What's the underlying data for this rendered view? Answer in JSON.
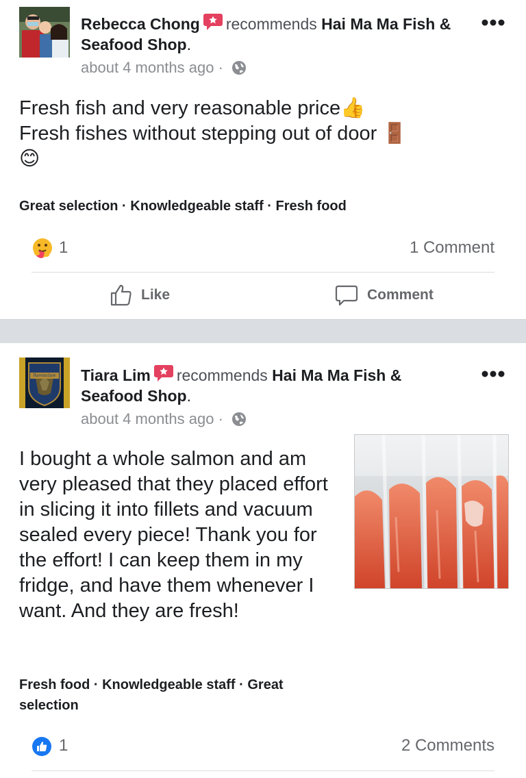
{
  "posts": [
    {
      "author": "Rebecca Chong",
      "recommends_label": "recommends",
      "shop_name": "Hai Ma Ma Fish & Seafood Shop",
      "shop_suffix": ".",
      "time": "about 4 months ago",
      "time_sep": "·",
      "body_lines": [
        "Fresh fish and very reasonable price👍",
        "Fresh fishes without stepping out of door 🚪",
        "😊"
      ],
      "tags": "Great selection · Knowledgeable staff · Fresh food",
      "reaction_icon": "hug-emoji-icon",
      "reaction_count": "1",
      "comments": "1 Comment",
      "like_label": "Like",
      "comment_label": "Comment"
    },
    {
      "author": "Tiara Lim",
      "recommends_label": "recommends",
      "shop_name": "Hai Ma Ma Fish & Seafood Shop",
      "shop_suffix": ".",
      "time": "about 4 months ago",
      "time_sep": "·",
      "body": "I bought a whole salmon and am very pleased that they placed effort in slicing it into fillets and vacuum sealed every piece! Thank you for the effort! I can keep them in my fridge, and have them whenever I want. And they are fresh!",
      "avatar_text": "Ravenclaw",
      "tags": "Fresh food · Knowledgeable staff · Great selection",
      "reaction_icon": "like-thumb-icon",
      "reaction_count": "1",
      "comments": "2 Comments"
    }
  ],
  "colors": {
    "accent_red": "#e4405f",
    "like_blue": "#1877f2",
    "muted_text": "#65676b",
    "separator": "#dadde1"
  }
}
